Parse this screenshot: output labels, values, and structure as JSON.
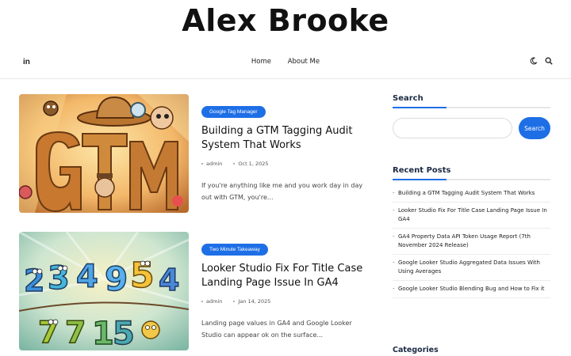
{
  "site": {
    "title": "Alex Brooke"
  },
  "nav": {
    "social_icon": "linkedin-icon",
    "items": [
      {
        "label": "Home"
      },
      {
        "label": "About Me"
      }
    ],
    "theme_icon": "moon-icon",
    "search_icon": "search-icon"
  },
  "posts": [
    {
      "category": "Google Tag Manager",
      "title": "Building a GTM Tagging Audit System That Works",
      "author": "admin",
      "date": "Oct 1, 2025",
      "excerpt": "If you're anything like me and you work day in day out with GTM, you're..."
    },
    {
      "category": "Two Minute Takeaway",
      "title": "Looker Studio Fix For Title Case Landing Page Issue In GA4",
      "author": "admin",
      "date": "Jan 14, 2025",
      "excerpt": "Landing page values in GA4 and Google Looker Studio can appear ok on the surface..."
    }
  ],
  "sidebar": {
    "search": {
      "title": "Search",
      "placeholder": "",
      "button_label": "Search"
    },
    "recent_posts": {
      "title": "Recent Posts",
      "items": [
        {
          "label": "Building a GTM Tagging Audit System That Works"
        },
        {
          "label": "Looker Studio Fix For Title Case Landing Page Issue In GA4"
        },
        {
          "label": "GA4 Property Data API Token Usage Report (7th November 2024 Release)"
        },
        {
          "label": "Google Looker Studio Aggregated Data Issues With Using Averages"
        },
        {
          "label": "Google Looker Studio Blending Bug and How to Fix it"
        }
      ]
    },
    "categories_title": "Categories"
  },
  "colors": {
    "accent": "#1e6fe6",
    "text": "#111111"
  }
}
